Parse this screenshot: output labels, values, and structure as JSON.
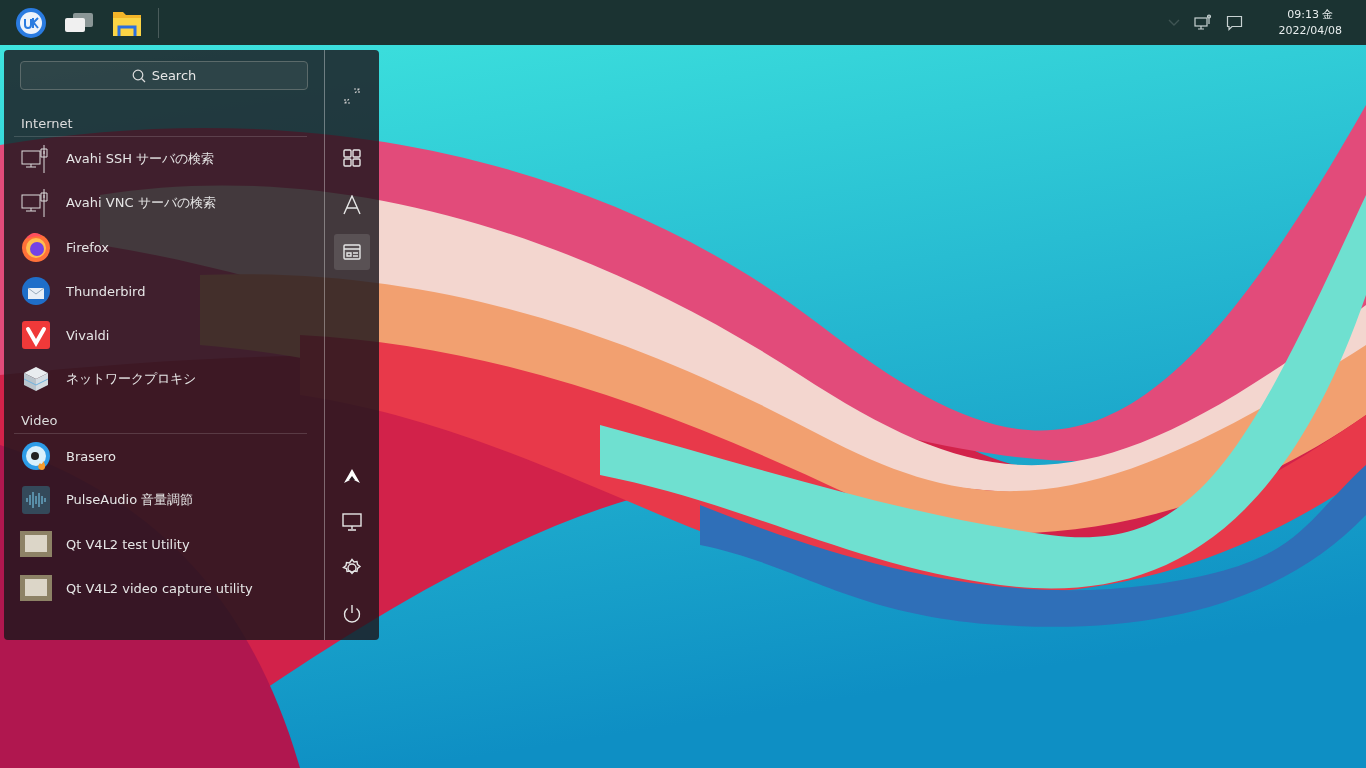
{
  "taskbar": {
    "clock": {
      "time": "09:13 金",
      "date": "2022/04/08"
    }
  },
  "menu": {
    "search": {
      "placeholder": "Search"
    },
    "categories": [
      {
        "title": "Internet",
        "apps": [
          {
            "name": "Avahi SSH サーバの検索",
            "kind": "network"
          },
          {
            "name": "Avahi VNC サーバの検索",
            "kind": "network"
          },
          {
            "name": "Firefox",
            "kind": "firefox"
          },
          {
            "name": "Thunderbird",
            "kind": "thunderbird"
          },
          {
            "name": "Vivaldi",
            "kind": "vivaldi"
          },
          {
            "name": "ネットワークプロキシ",
            "kind": "proxy"
          }
        ]
      },
      {
        "title": "Video",
        "apps": [
          {
            "name": "Brasero",
            "kind": "disc"
          },
          {
            "name": "PulseAudio 音量調節",
            "kind": "audio"
          },
          {
            "name": "Qt V4L2 test Utility",
            "kind": "tv"
          },
          {
            "name": "Qt V4L2 video capture utility",
            "kind": "tv"
          }
        ]
      }
    ],
    "view_buttons": [
      {
        "kind": "grid",
        "selected": false
      },
      {
        "kind": "alpha",
        "selected": false
      },
      {
        "kind": "category",
        "selected": true
      }
    ]
  }
}
